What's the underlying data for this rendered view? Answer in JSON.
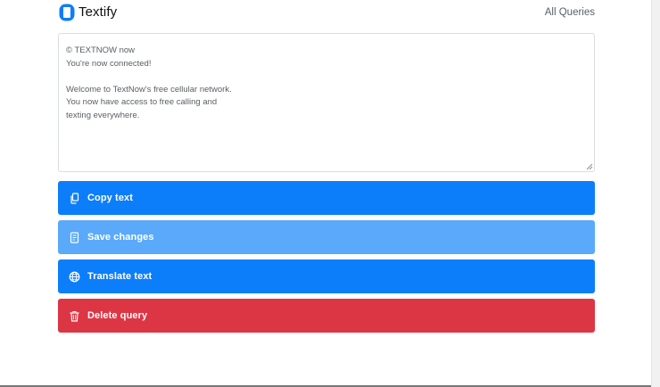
{
  "app": {
    "brand": "Textify",
    "nav_link": "All Queries"
  },
  "editor": {
    "text": "© TEXTNOW now\nYou're now connected!\n\nWelcome to TextNow's free cellular network.\nYou now have access to free calling and\ntexting everywhere."
  },
  "actions": [
    {
      "label": "Copy text",
      "icon": "copy-icon",
      "color": "#0d7ef9"
    },
    {
      "label": "Save changes",
      "icon": "save-icon",
      "color": "#5aa9fb"
    },
    {
      "label": "Translate text",
      "icon": "globe-icon",
      "color": "#0d7ef9"
    },
    {
      "label": "Delete query",
      "icon": "trash-icon",
      "color": "#dc3645"
    }
  ],
  "colors": {
    "logo": "#0d7ef9",
    "primary": "#0d7ef9",
    "primary_disabled": "#5aa9fb",
    "danger": "#dc3645"
  }
}
